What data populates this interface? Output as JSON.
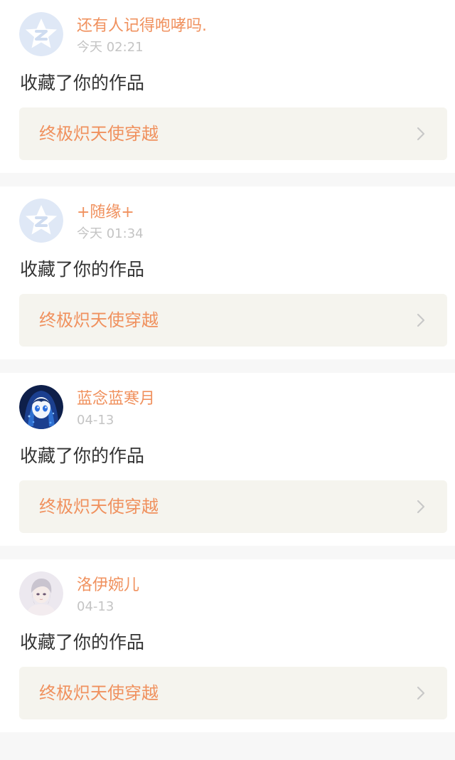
{
  "theme": {
    "accent": "#f0915e",
    "card_bg": "#ffffff",
    "page_bg": "#f7f7f7",
    "link_bg": "#f5f4ee",
    "muted": "#c4c4c4",
    "text": "#333333"
  },
  "notifications": [
    {
      "username": "还有人记得咆哮吗.",
      "time": "今天 02:21",
      "action": "收藏了你的作品",
      "work_title": "终极炽天使穿越",
      "avatar_icon": "default-avatar-icon"
    },
    {
      "username": "+随缘+",
      "time": "今天 01:34",
      "action": "收藏了你的作品",
      "work_title": "终极炽天使穿越",
      "avatar_icon": "default-avatar-icon"
    },
    {
      "username": "蓝念蓝寒月",
      "time": "04-13",
      "action": "收藏了你的作品",
      "work_title": "终极炽天使穿越",
      "avatar_icon": "anime-girl-blue-avatar"
    },
    {
      "username": "洛伊婉儿",
      "time": "04-13",
      "action": "收藏了你的作品",
      "work_title": "终极炽天使穿越",
      "avatar_icon": "anime-boy-silver-avatar"
    }
  ]
}
